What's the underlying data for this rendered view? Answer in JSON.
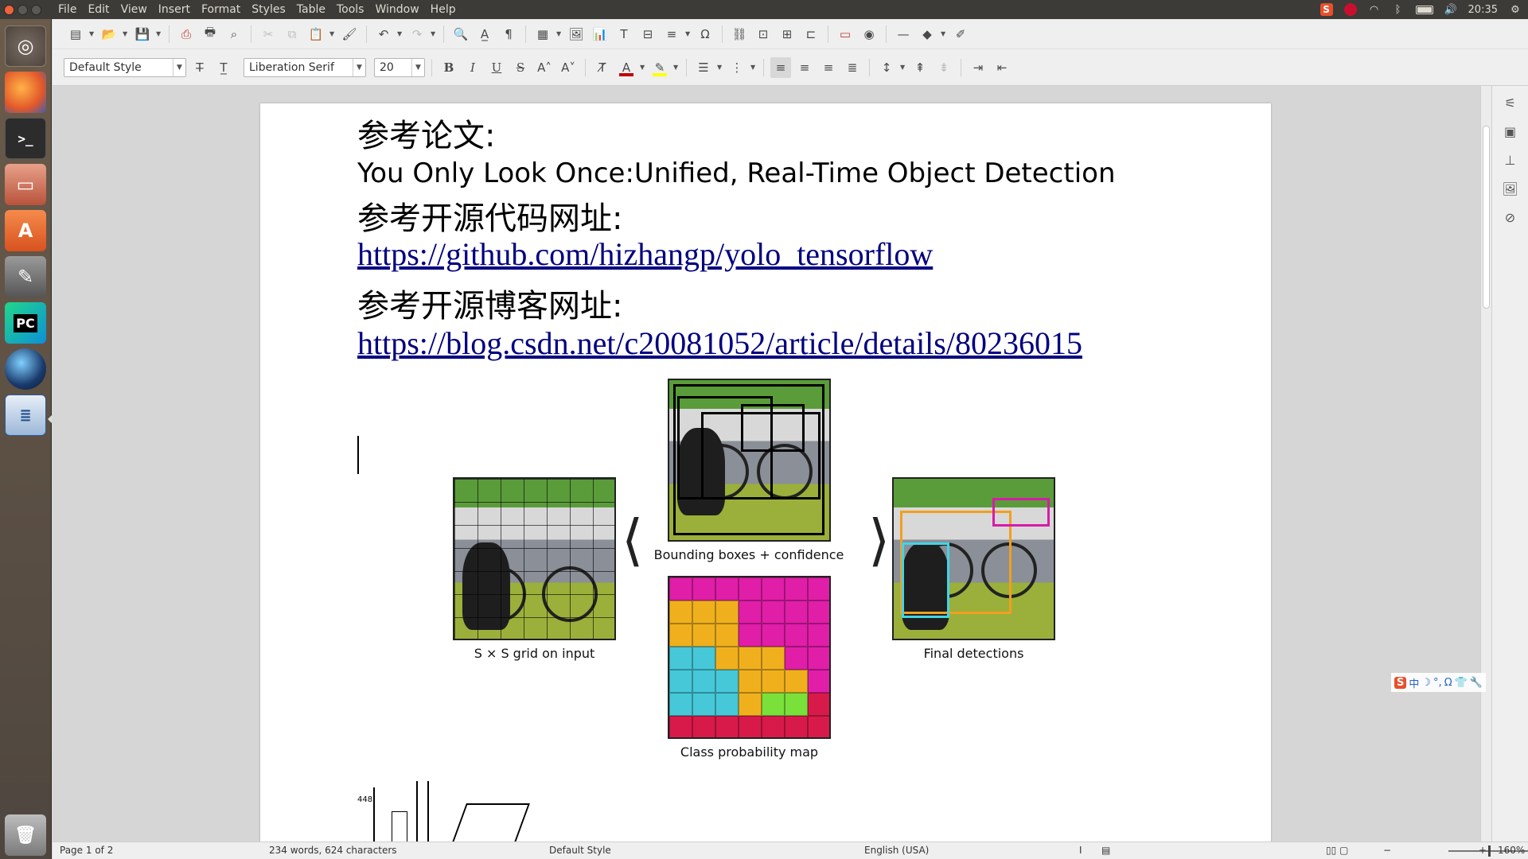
{
  "menubar": {
    "items": [
      "File",
      "Edit",
      "View",
      "Insert",
      "Format",
      "Styles",
      "Table",
      "Tools",
      "Window",
      "Help"
    ],
    "clock": "20:35"
  },
  "launcher": {
    "items": [
      "dash-home",
      "firefox",
      "terminal",
      "files",
      "software-center",
      "system-settings",
      "pycharm",
      "globe-app",
      "libreoffice-writer",
      "trash"
    ]
  },
  "formatting": {
    "paragraph_style": "Default Style",
    "font_name": "Liberation Serif",
    "font_size": "20",
    "font_color": "#c00000",
    "highlight_color": "#ffff00"
  },
  "document": {
    "heading1": "参考论文:",
    "paper_title": "You Only Look Once:Unified, Real-Time Object Detection",
    "heading2": "参考开源代码网址:",
    "link1": "https://github.com/hizhangp/yolo_tensorflow",
    "heading3": "参考开源博客网址:",
    "link2": "https://blog.csdn.net/c20081052/article/details/80236015",
    "figure": {
      "caption_grid": "S × S grid on input",
      "caption_boxes": "Bounding boxes + confidence",
      "caption_probmap": "Class probability map",
      "caption_final": "Final detections"
    },
    "next_figure_label": "448"
  },
  "statusbar": {
    "page": "Page 1 of 2",
    "words": "234 words, 624 characters",
    "style": "Default Style",
    "language": "English (USA)",
    "zoom": "160%"
  },
  "ime": {
    "label": "中"
  }
}
